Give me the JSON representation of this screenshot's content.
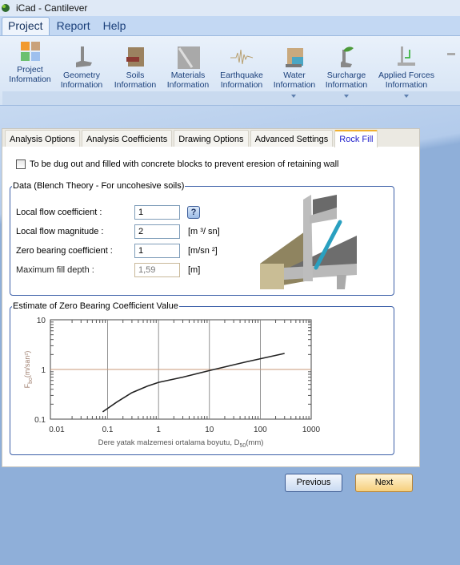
{
  "window": {
    "title": "iCad - Cantilever"
  },
  "menu": {
    "tabs": [
      "Project",
      "Report",
      "Help"
    ],
    "active": "Project"
  },
  "ribbon": {
    "items": [
      {
        "label1": "Project",
        "label2": "Information",
        "icon": "project-info-icon",
        "dropdown": false
      },
      {
        "label1": "Geometry",
        "label2": "Information",
        "icon": "geometry-icon",
        "dropdown": false
      },
      {
        "label1": "Soils",
        "label2": "Information",
        "icon": "soils-icon",
        "dropdown": false
      },
      {
        "label1": "Materials",
        "label2": "Information",
        "icon": "materials-icon",
        "dropdown": false
      },
      {
        "label1": "Earthquake",
        "label2": "Information",
        "icon": "earthquake-icon",
        "dropdown": false
      },
      {
        "label1": "Water",
        "label2": "Information",
        "icon": "water-icon",
        "dropdown": true
      },
      {
        "label1": "Surcharge",
        "label2": "Information",
        "icon": "surcharge-icon",
        "dropdown": true
      },
      {
        "label1": "Applied Forces",
        "label2": "Information",
        "icon": "applied-forces-icon",
        "dropdown": true
      }
    ]
  },
  "tabs": [
    "Analysis Options",
    "Analysis Coefficients",
    "Drawing Options",
    "Advanced Settings",
    "Rock Fill"
  ],
  "active_tab": "Rock Fill",
  "checkbox": {
    "label": "To be dug out and filled with concrete blocks to prevent eresion of retaining wall",
    "checked": false
  },
  "data_group": {
    "title": "Data (Blench Theory - For uncohesive soils)",
    "fields": [
      {
        "label": "Local flow coefficient :",
        "value": "1",
        "unit": "",
        "help": "?"
      },
      {
        "label": "Local flow magnitude :",
        "value": "2",
        "unit": "[m ³/ sn]"
      },
      {
        "label": "Zero bearing coefficient :",
        "value": "1",
        "unit": "[m/sn ²]"
      },
      {
        "label": "Maximum fill depth :",
        "value": "1,59",
        "unit": "[m]",
        "disabled": true
      }
    ]
  },
  "chart_group": {
    "title": "Estimate of Zero Bearing Coefficient Value"
  },
  "chart_data": {
    "type": "line",
    "xscale": "log",
    "yscale": "log",
    "xlim": [
      0.0075,
      1000
    ],
    "ylim": [
      0.1,
      10
    ],
    "xticks": [
      "0.01",
      "0.1",
      "1",
      "10",
      "100",
      "1000"
    ],
    "xtick_values": [
      0.01,
      0.1,
      1,
      10,
      100,
      1000
    ],
    "yticks": [
      "0.1",
      "1",
      "10"
    ],
    "ytick_values": [
      0.1,
      1,
      10
    ],
    "xlabel": "Dere yatak malzemesi ortalama boyutu, D",
    "xlabel_sub": "50",
    "xlabel_unit": "(mm)",
    "ylabel": "F",
    "ylabel_sub": "bo",
    "ylabel_unit": "(m/san²)",
    "grid": true,
    "reference_line_y": 1,
    "reference_line_color": "#c89a7a",
    "x": [
      0.08,
      0.15,
      0.3,
      0.6,
      1,
      3,
      10,
      50,
      300
    ],
    "y": [
      0.14,
      0.22,
      0.34,
      0.46,
      0.55,
      0.7,
      0.95,
      1.4,
      2.1
    ]
  },
  "buttons": {
    "previous": "Previous",
    "next": "Next"
  }
}
